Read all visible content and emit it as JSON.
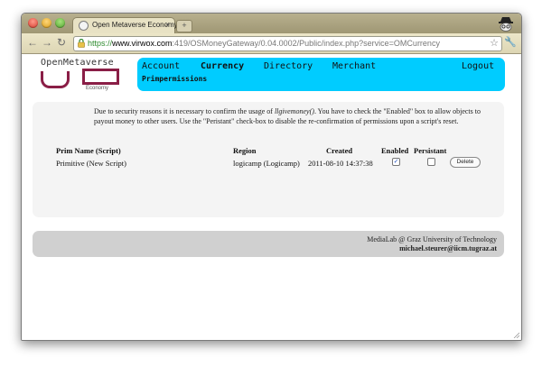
{
  "browser": {
    "tab_title": "Open Metaverse Economy",
    "tab_close": "×",
    "new_tab": "+",
    "back": "←",
    "forward": "→",
    "reload": "↻",
    "url_proto": "https://",
    "url_host": "www.virwox.com",
    "url_path": ":419/OSMoneyGateway/0.04.0002/Public/index.php?service=OMCurrency",
    "star": "☆",
    "wrench": "🔧"
  },
  "logo": {
    "title": "OpenMetaverse",
    "subtitle": "Economy"
  },
  "nav": {
    "items": [
      {
        "label": "Account"
      },
      {
        "label": "Currency"
      },
      {
        "label": "Directory"
      },
      {
        "label": "Merchant"
      },
      {
        "label": "Logout"
      }
    ],
    "sub": "Primpermissions"
  },
  "notice": {
    "before": "Due to security reasons it is necessary to confirm the usage of ",
    "func": "llgivemoney()",
    "after": ". You have to check the \"Enabled\" box to allow objects to payout money to other users. Use the \"Peristant\" check-box to disable the re-confirmation of permissions upon a script's reset."
  },
  "table": {
    "headers": {
      "prim": "Prim Name (Script)",
      "region": "Region",
      "created": "Created",
      "enabled": "Enabled",
      "persistant": "Persistant"
    },
    "rows": [
      {
        "prim": "Primitive (New Script)",
        "region": "logicamp (Logicamp)",
        "created": "2011-08-10 14:37:38",
        "enabled": true,
        "persistant": false,
        "delete": "Delete"
      }
    ]
  },
  "footer": {
    "line1": "MediaLab @ Graz University of Technology",
    "line2": "michael.steurer@iicm.tugraz.at"
  }
}
